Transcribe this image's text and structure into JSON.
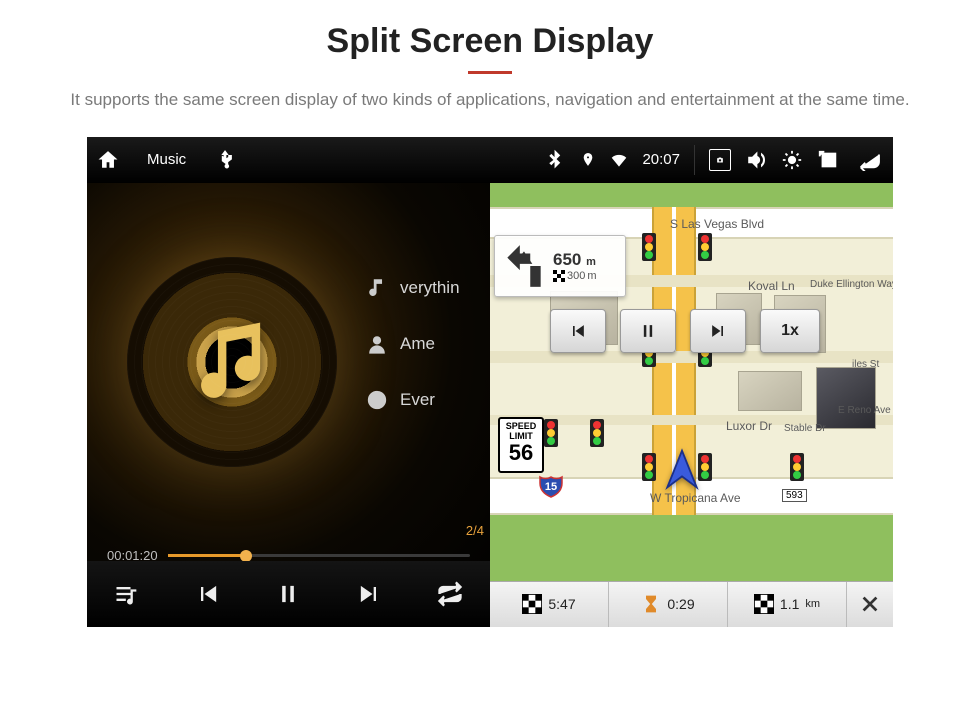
{
  "header": {
    "title": "Split Screen Display",
    "subtitle": "It supports the same screen display of two kinds of applications, navigation and entertainment at the same time."
  },
  "statusbar": {
    "app_label": "Music",
    "usb_icon_name": "usb-icon",
    "time": "20:07"
  },
  "music": {
    "track1": "verythin",
    "track2": "Ame",
    "track3": "Ever",
    "counter": "2/4",
    "elapsed": "00:01:20"
  },
  "map": {
    "turn": {
      "distance": "650",
      "distance_unit": "m",
      "sub_distance": "300",
      "sub_unit": "m"
    },
    "speed_limit": {
      "label_top": "SPEED",
      "label_mid": "LIMIT",
      "value": "56"
    },
    "playback_speed": "1x",
    "streets": {
      "vegas": "S Las Vegas Blvd",
      "koval": "Koval Ln",
      "duke": "Duke Ellington Way",
      "luxor": "Luxor Dr",
      "stable": "Stable Dr",
      "reno": "E Reno Ave",
      "giles": "iles St",
      "tropicana": "W Tropicana Ave",
      "exit_593": "593"
    },
    "highway": "15",
    "info": {
      "eta": "5:47",
      "travel_time": "0:29",
      "distance": "1.1",
      "distance_unit": "km"
    }
  }
}
